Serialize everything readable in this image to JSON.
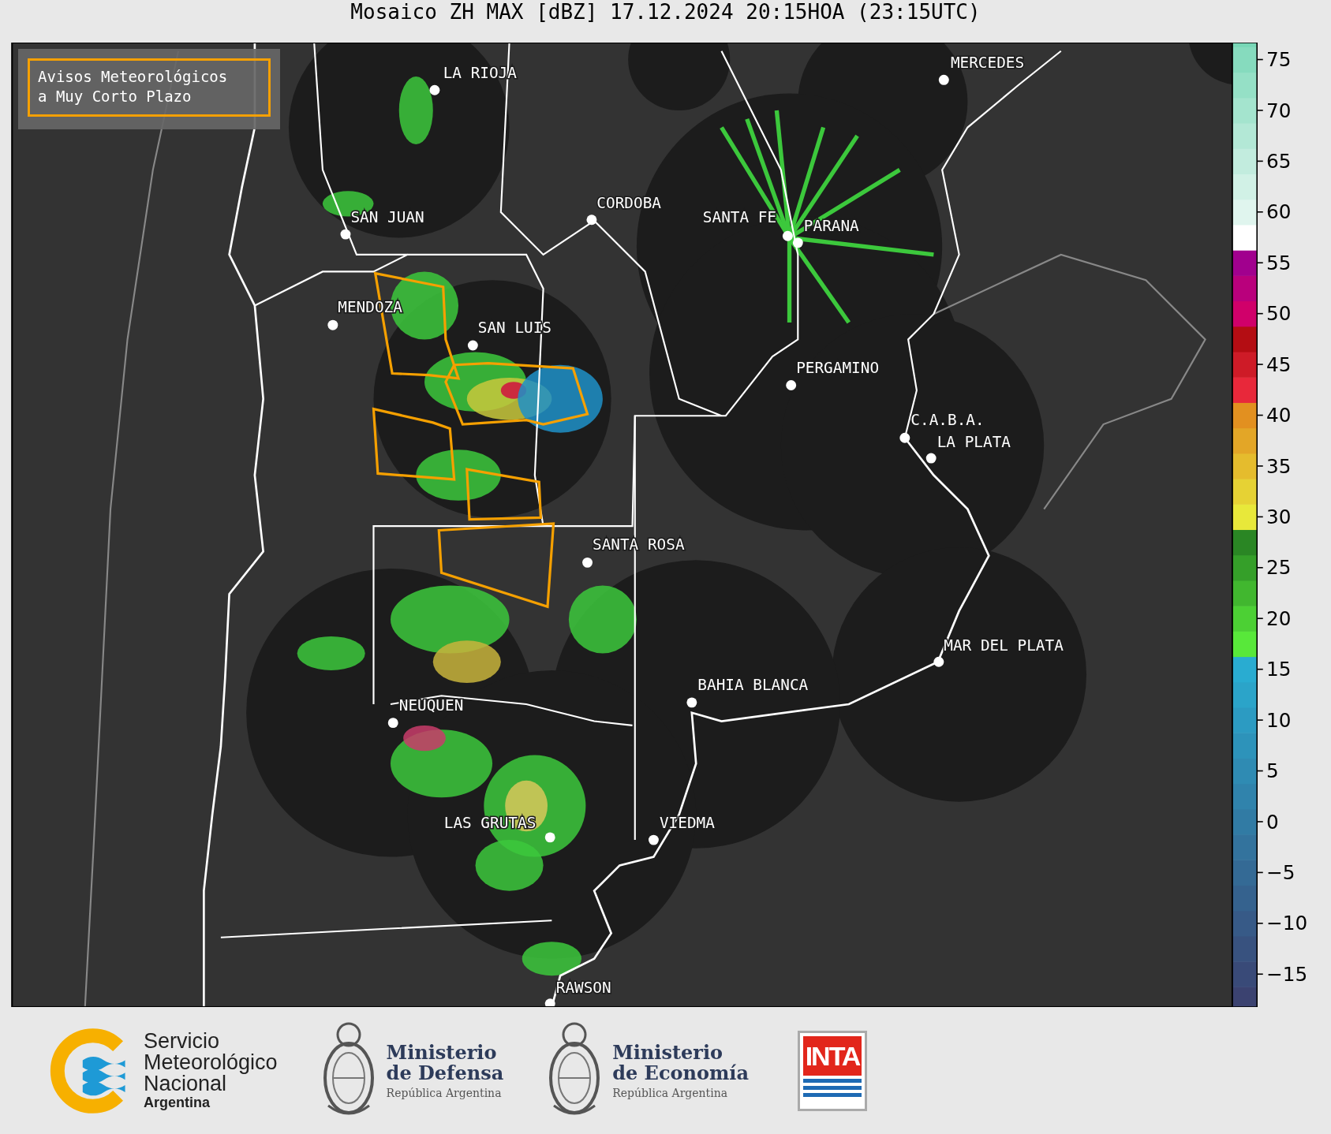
{
  "title": "Mosaico ZH MAX [dBZ] 17.12.2024 20:15HOA (23:15UTC)",
  "map": {
    "legend": {
      "lines": [
        "Avisos Meteorológicos",
        "a Muy Corto Plazo"
      ]
    },
    "cities": [
      "LA RIOJA",
      "MERCEDES",
      "CORDOBA",
      "SAN JUAN",
      "SANTA FE",
      "PARANA",
      "MENDOZA",
      "SAN LUIS",
      "PERGAMINO",
      "C.A.B.A.",
      "LA PLATA",
      "SANTA ROSA",
      "MAR DEL PLATA",
      "BAHIA BLANCA",
      "NEUQUEN",
      "LAS GRUTAS",
      "VIEDMA",
      "RAWSON"
    ]
  },
  "colorbar": {
    "ticks": [
      "75",
      "70",
      "65",
      "60",
      "55",
      "50",
      "45",
      "40",
      "35",
      "30",
      "25",
      "20",
      "15",
      "10",
      "5",
      "0",
      "−5",
      "−10",
      "−15"
    ]
  },
  "logos": [
    {
      "kind": "smn",
      "lines": [
        "Servicio",
        "Meteorológico",
        "Nacional"
      ],
      "subtitle": "Argentina"
    },
    {
      "kind": "ministry",
      "lines": [
        "Ministerio",
        "de Defensa"
      ],
      "subtitle": "República Argentina"
    },
    {
      "kind": "ministry",
      "lines": [
        "Ministerio",
        "de Economía"
      ],
      "subtitle": "República Argentina"
    },
    {
      "kind": "inta",
      "text": "INTA"
    }
  ]
}
